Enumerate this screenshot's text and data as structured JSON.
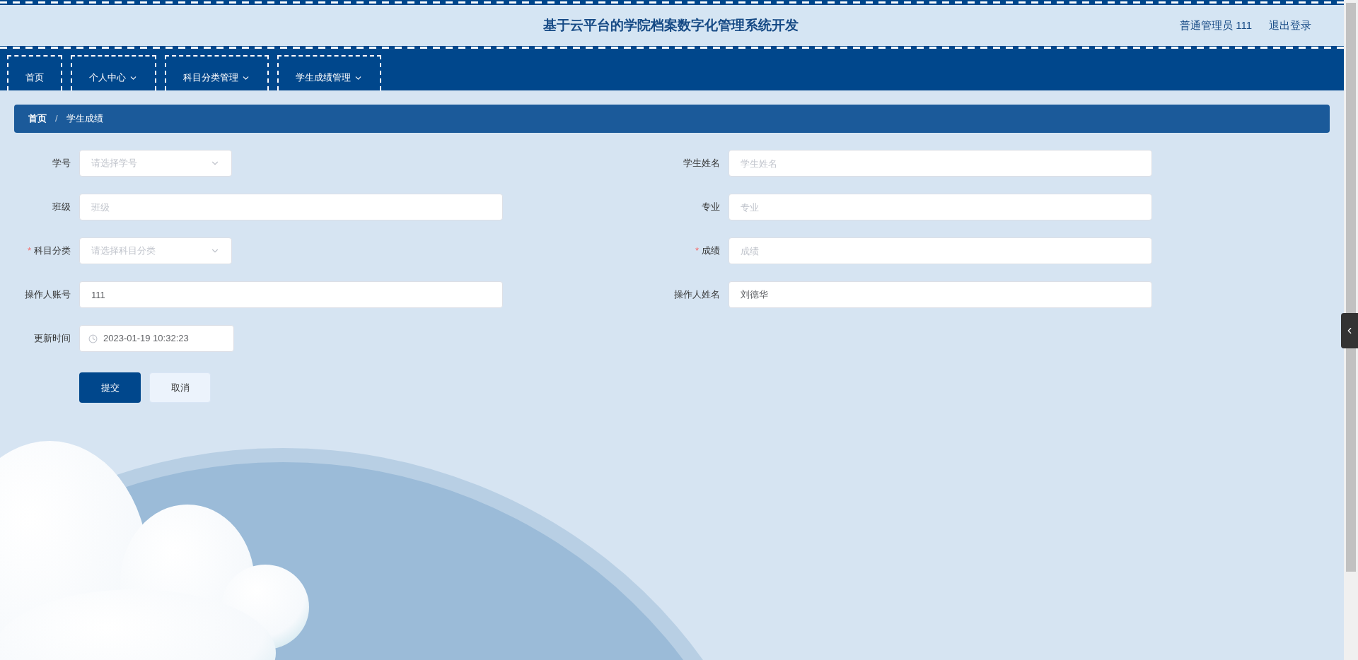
{
  "header": {
    "title": "基于云平台的学院档案数字化管理系统开发",
    "user": "普通管理员 111",
    "logout": "退出登录"
  },
  "nav": [
    {
      "label": "首页",
      "dropdown": false
    },
    {
      "label": "个人中心",
      "dropdown": true
    },
    {
      "label": "科目分类管理",
      "dropdown": true
    },
    {
      "label": "学生成绩管理",
      "dropdown": true
    }
  ],
  "breadcrumb": {
    "items": [
      "首页",
      "学生成绩"
    ],
    "separator": "/"
  },
  "form": {
    "left": [
      {
        "kind": "select",
        "label": "学号",
        "placeholder": "请选择学号"
      },
      {
        "kind": "text",
        "label": "班级",
        "placeholder": "班级"
      },
      {
        "kind": "select",
        "label": "科目分类",
        "required_mark": "*",
        "placeholder": "请选择科目分类"
      },
      {
        "kind": "text",
        "label": "操作人账号",
        "value": "111"
      },
      {
        "kind": "datetime",
        "label": "更新时间",
        "value": "2023-01-19 10:32:23"
      }
    ],
    "right": [
      {
        "kind": "text",
        "label": "学生姓名",
        "placeholder": "学生姓名"
      },
      {
        "kind": "text",
        "label": "专业",
        "placeholder": "专业"
      },
      {
        "kind": "text",
        "label": "成绩",
        "required_mark": "*",
        "placeholder": "成绩"
      },
      {
        "kind": "text",
        "label": "操作人姓名",
        "value": "刘德华"
      }
    ]
  },
  "buttons": [
    {
      "label": "提交",
      "primary": true
    },
    {
      "label": "取消",
      "primary": false
    }
  ]
}
